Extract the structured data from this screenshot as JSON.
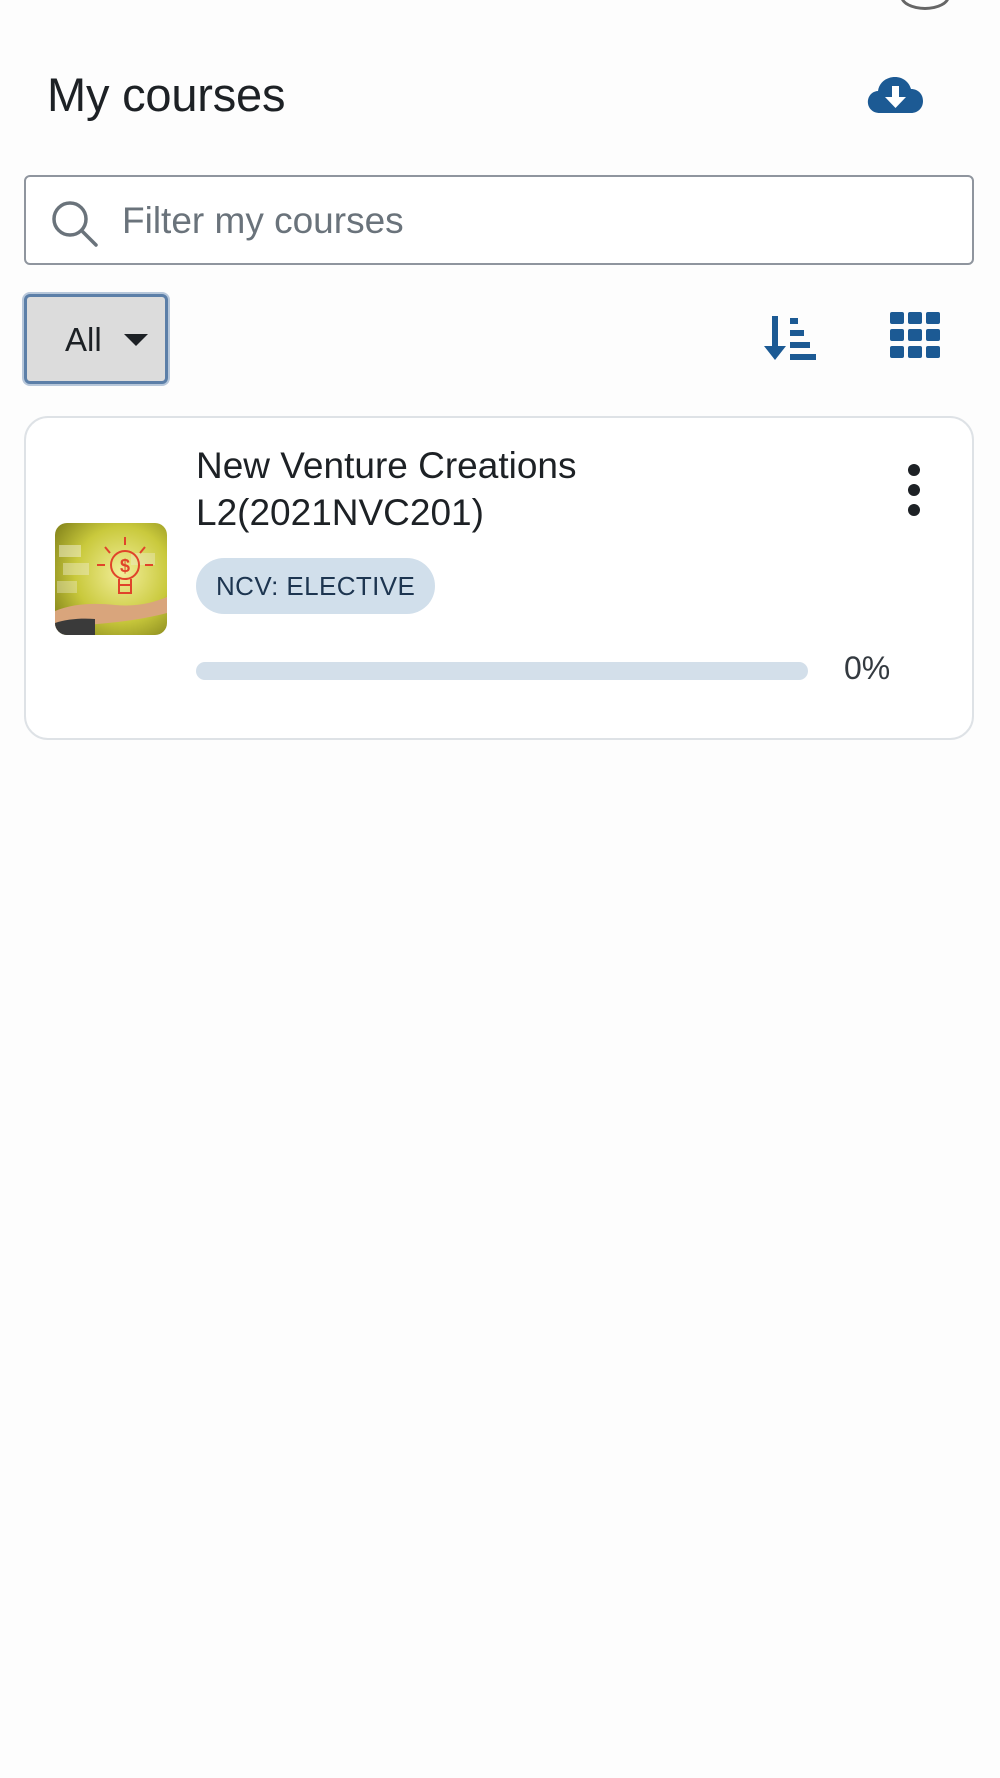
{
  "header": {
    "title": "My courses",
    "download_icon": "cloud-download-icon"
  },
  "search": {
    "placeholder": "Filter my courses",
    "value": "",
    "icon": "search-icon"
  },
  "filter": {
    "selected": "All"
  },
  "toolbar": {
    "sort_icon": "sort-ascending-icon",
    "view_icon": "grid-view-icon"
  },
  "courses": [
    {
      "title_line1": "New Venture Creations",
      "title_line2": "L2(2021NVC201)",
      "category": "NCV: ELECTIVE",
      "progress": 0,
      "progress_text": "0%"
    }
  ],
  "colors": {
    "accent": "#1c5a94",
    "badge_bg": "#d1dfeb",
    "progress_track": "#d3dfea"
  }
}
